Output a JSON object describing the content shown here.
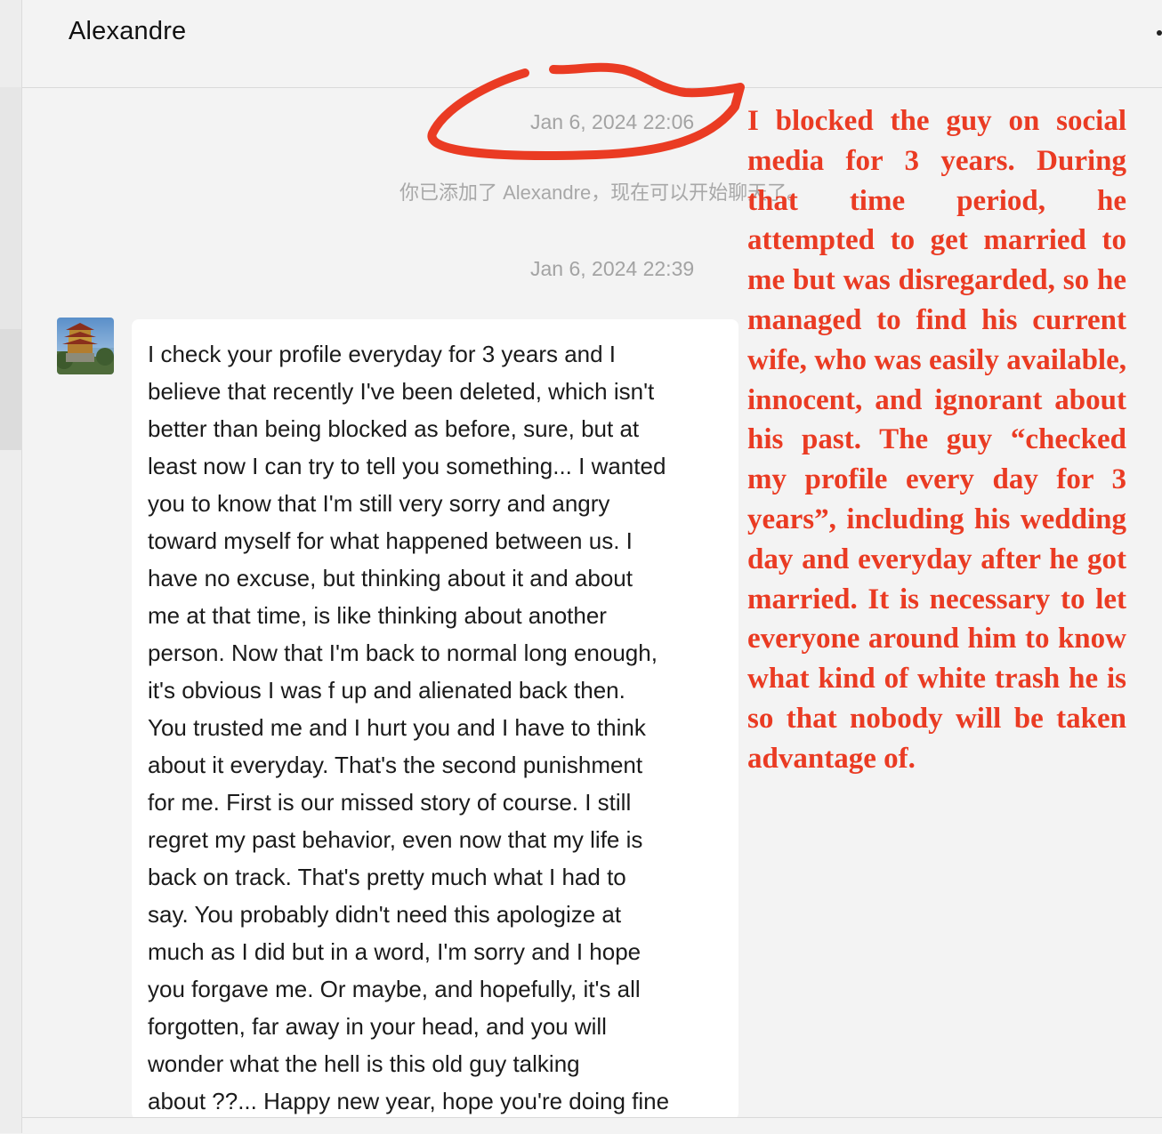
{
  "chat": {
    "title": "Alexandre"
  },
  "messages": {
    "timestamp_1": "Jan 6, 2024 22:06",
    "system_notice": "你已添加了 Alexandre，现在可以开始聊天了。",
    "timestamp_2": "Jan 6, 2024 22:39",
    "incoming": {
      "lines": [
        "I check your profile everyday for 3 years and I",
        "believe that recently I've been deleted, which isn't",
        "better than being blocked as before, sure, but at",
        "least now I can try to tell you something... I wanted",
        "you to know that I'm still very sorry and angry",
        "toward myself for what happened between us. I",
        "have no excuse, but thinking about it and about",
        "me at that time, is like thinking about another",
        "person. Now that I'm back to normal long enough,",
        "it's obvious I was f up and alienated back then.",
        "You trusted me and I hurt you and I have to think",
        "about it everyday. That's the second punishment",
        "for me. First is our missed story of course. I still",
        "regret my past behavior, even now that my life is",
        "back on track. That's pretty much what I had to",
        "say. You probably didn't need this apologize at",
        "much as I did but in a word, I'm sorry and I hope",
        "you forgave me. Or maybe, and hopefully, it's all",
        "forgotten, far away in your head, and you will",
        "wonder what the hell is this old guy talking",
        "about ??... Happy new year, hope you're doing fine"
      ]
    }
  },
  "annotation": {
    "text": "I blocked the guy on social media for 3 years. During that time period, he attempted to get married to me but was disregarded, so he managed to find his current wife, who was easily available, innocent, and ignorant about his past.  The guy “checked my profile every day for 3 years”, including his wedding day and everyday after he got married. It is necessary to let everyone around him to know what kind of white trash he is so that nobody will be taken advantage of.",
    "color": "#ea3b23"
  },
  "icons": {
    "avatar": "pagoda-photo-avatar",
    "more": "more-dots-icon"
  }
}
